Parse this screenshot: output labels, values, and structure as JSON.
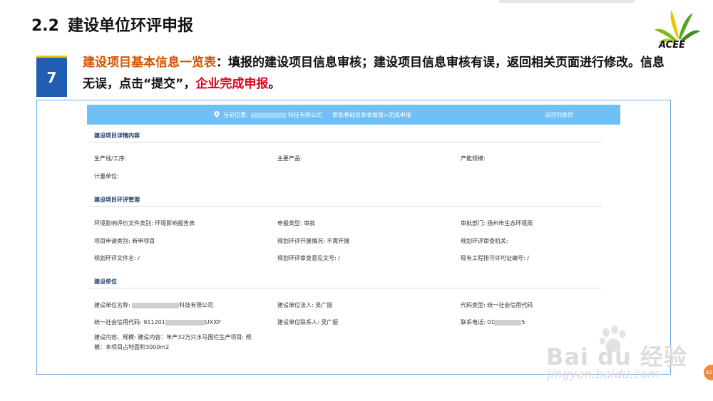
{
  "slide": {
    "number": "2.2",
    "title": "建设单位环评申报",
    "logo_text": "ACEE",
    "step": "7",
    "desc_highlight": "建设项目基本信息一览表",
    "desc_main": "：填报的建设项目信息审核；建设项目信息审核有误，返回相关页面进行修改。信息无误，点击“提交”，",
    "desc_red": "企业完成申报",
    "desc_end": "。"
  },
  "topbar": {
    "location_label": "当前位置:",
    "company_suffix": "科技有限公司",
    "path": "审批基础信息表填报>完成申报",
    "back_link": "返回列表页"
  },
  "sections": {
    "detail": "建设项目详情内容",
    "eia": "建设项目环评管理",
    "unit": "建设单位"
  },
  "detail_fields": {
    "line": "生产线/工序:",
    "product": "主要产品:",
    "capacity": "产能规模:",
    "unit_measure": "计量单位:"
  },
  "eia_fields": {
    "doc_type": "环境影响评价文件类别: 环境影响报告表",
    "report_type": "申报类型: 审批",
    "approval_dept": "审批部门: 扬州市生态环境局",
    "apply_type": "项目申请类别: 新申项目",
    "plan_status": "规划环评开展情况: 不需开展",
    "plan_authority": "规划环评审查机关:",
    "plan_doc": "规划环评文件名: /",
    "plan_opinion": "规划环评审查意见文号: /",
    "permit_no": "现有工程排污许可证编号: /"
  },
  "unit_fields": {
    "name_label": "建设单位名称:",
    "name_suffix": "科技有限公司",
    "legal_person": "建设单位法人: 吴广振",
    "code_type": "代码类型: 统一社会信用代码",
    "credit_label": "统一社会信用代码: 911201",
    "credit_suffix": "UXXP",
    "contact": "建设单位联系人: 吴广振",
    "phone_label": "联系电话: 01",
    "phone_suffix": "5",
    "content_line1": "建设内容、规模: 建设内容：年产32万只水马围栏生产项目; 规",
    "content_line2": "模：本项目占地面积3000m2"
  },
  "watermark": {
    "brand": "Bai du 经验",
    "url": "jingyan.baidu.com"
  },
  "page_badge": "63",
  "colors": {
    "step_box": "#1f5eb0",
    "highlight_orange": "#d35400",
    "highlight_red": "#e0001b",
    "topbar": "#6ec0f5",
    "frame_border": "#6fa9e8"
  }
}
